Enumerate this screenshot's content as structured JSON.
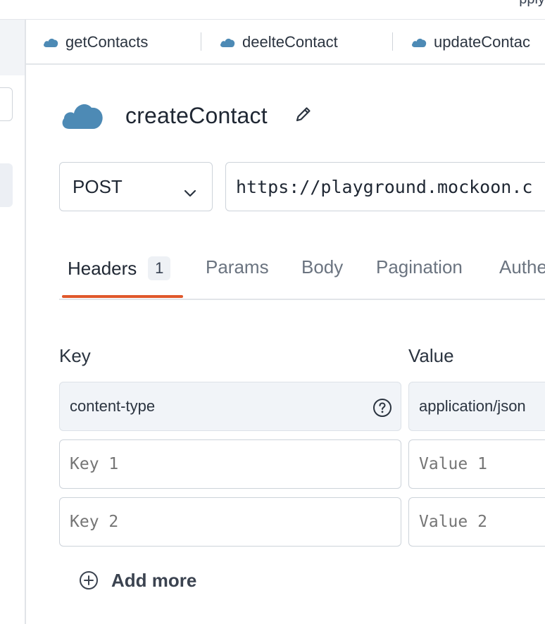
{
  "colors": {
    "accent": "#e0582b",
    "cloud": "#4d8ab5",
    "border": "#cdd3da",
    "filled_bg": "#f1f4f8"
  },
  "topbar": {
    "clipped_text": "pply"
  },
  "request_tabs": [
    {
      "label": "getContacts",
      "icon": "cloud-icon"
    },
    {
      "label": "deelteContact",
      "icon": "cloud-icon"
    },
    {
      "label": "updateContac",
      "icon": "cloud-icon"
    }
  ],
  "header": {
    "title": "createContact",
    "icon": "cloud-icon",
    "edit_icon": "pencil-icon"
  },
  "request": {
    "method": "POST",
    "url": "https://playground.mockoon.c"
  },
  "sub_tabs": [
    {
      "label": "Headers",
      "badge": "1",
      "active": true
    },
    {
      "label": "Params"
    },
    {
      "label": "Body"
    },
    {
      "label": "Pagination"
    },
    {
      "label": "Authe"
    }
  ],
  "headers_table": {
    "key_label": "Key",
    "value_label": "Value",
    "rows": [
      {
        "key": "content-type",
        "value": "application/json",
        "help_icon": "question-circle-icon"
      },
      {
        "key_placeholder": "Key 1",
        "value_placeholder": "Value 1"
      },
      {
        "key_placeholder": "Key 2",
        "value_placeholder": "Value 2"
      }
    ]
  },
  "add_more": {
    "label": "Add more",
    "icon": "plus-circle-icon"
  }
}
